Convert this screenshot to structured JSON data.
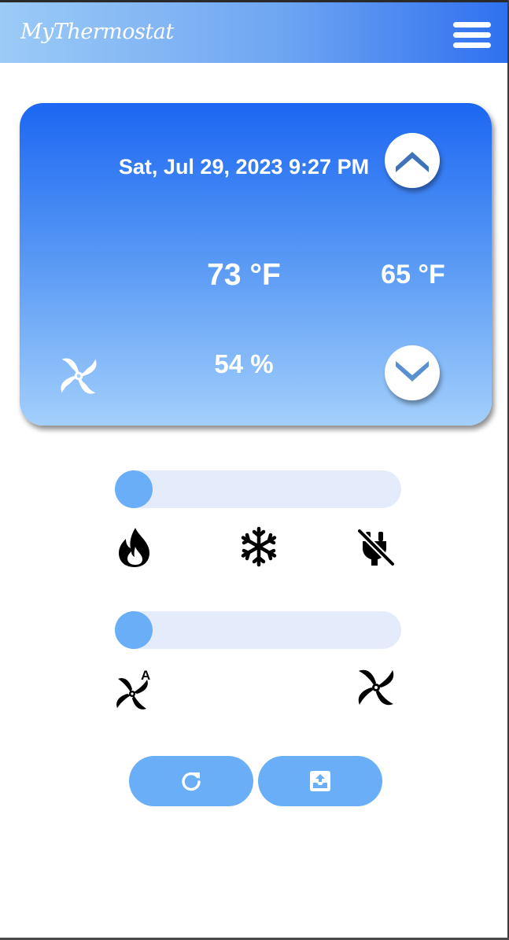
{
  "app": {
    "title": "MyThermostat"
  },
  "header": {
    "menu_icon": "hamburger-menu-icon"
  },
  "status": {
    "datetime": "Sat, Jul 29, 2023 9:27 PM",
    "current_temp": "73 °F",
    "setpoint": "65 °F",
    "humidity": "54 %",
    "fan_status_icon": "fan-icon"
  },
  "controls": {
    "setpoint_up_icon": "chevron-up-icon",
    "setpoint_down_icon": "chevron-down-icon",
    "mode_slider": {
      "position": 0,
      "options": [
        {
          "icon": "fire-icon",
          "meaning": "heat"
        },
        {
          "icon": "snowflake-icon",
          "meaning": "cool"
        },
        {
          "icon": "power-off-icon",
          "meaning": "off"
        }
      ]
    },
    "fan_slider": {
      "position": 0,
      "options": [
        {
          "icon": "fan-auto-icon",
          "badge": "A"
        },
        {
          "icon": "fan-icon",
          "meaning": "on"
        }
      ]
    }
  },
  "actions": [
    {
      "icon": "refresh-icon"
    },
    {
      "icon": "save-upload-icon"
    }
  ],
  "colors": {
    "header_gradient": [
      "#9ccbf7",
      "#2f70f0"
    ],
    "card_gradient": [
      "#1c67f2",
      "#a3cffb"
    ],
    "accent": "#6aaef7",
    "slider_track": "#e4ebfb"
  }
}
